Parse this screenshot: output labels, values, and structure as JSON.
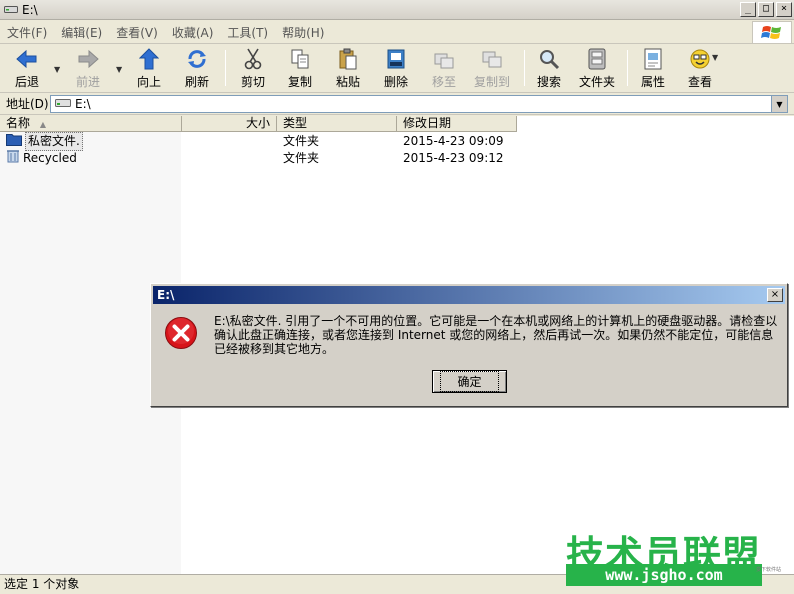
{
  "window": {
    "title": "E:\\",
    "minimize": "_",
    "maximize": "□",
    "close": "×"
  },
  "menubar": {
    "items": [
      "文件(F)",
      "编辑(E)",
      "查看(V)",
      "收藏(A)",
      "工具(T)",
      "帮助(H)"
    ]
  },
  "toolbar": {
    "back": "后退",
    "forward": "前进",
    "up": "向上",
    "refresh": "刷新",
    "cut": "剪切",
    "copy": "复制",
    "paste": "粘贴",
    "delete": "删除",
    "move_to": "移至",
    "copy_to": "复制到",
    "search": "搜索",
    "folders": "文件夹",
    "properties": "属性",
    "views": "查看"
  },
  "address": {
    "label": "地址(D)",
    "value": "E:\\"
  },
  "columns": {
    "name": "名称",
    "size": "大小",
    "type": "类型",
    "modified": "修改日期"
  },
  "files": [
    {
      "name": "私密文件.",
      "type": "文件夹",
      "modified": "2015-4-23 09:09"
    },
    {
      "name": "Recycled",
      "type": "文件夹",
      "modified": "2015-4-23 09:12"
    }
  ],
  "status": {
    "text": "选定 1 个对象"
  },
  "dialog": {
    "title": "E:\\",
    "message": "E:\\私密文件. 引用了一个不可用的位置。它可能是一个在本机或网络上的计算机上的硬盘驱动器。请检查以确认此盘正确连接，或者您连接到 Internet 或您的网络上，然后再试一次。如果仍然不能定位，可能信息已经被移到其它地方。",
    "ok": "确定",
    "close": "×"
  },
  "watermark": {
    "main": "技术员联盟",
    "url": "www.jsgho.com",
    "small": "变下软件站"
  },
  "colors": {
    "accent": "#0a246a",
    "watermark": "#27b34a",
    "error": "#d7141a"
  }
}
